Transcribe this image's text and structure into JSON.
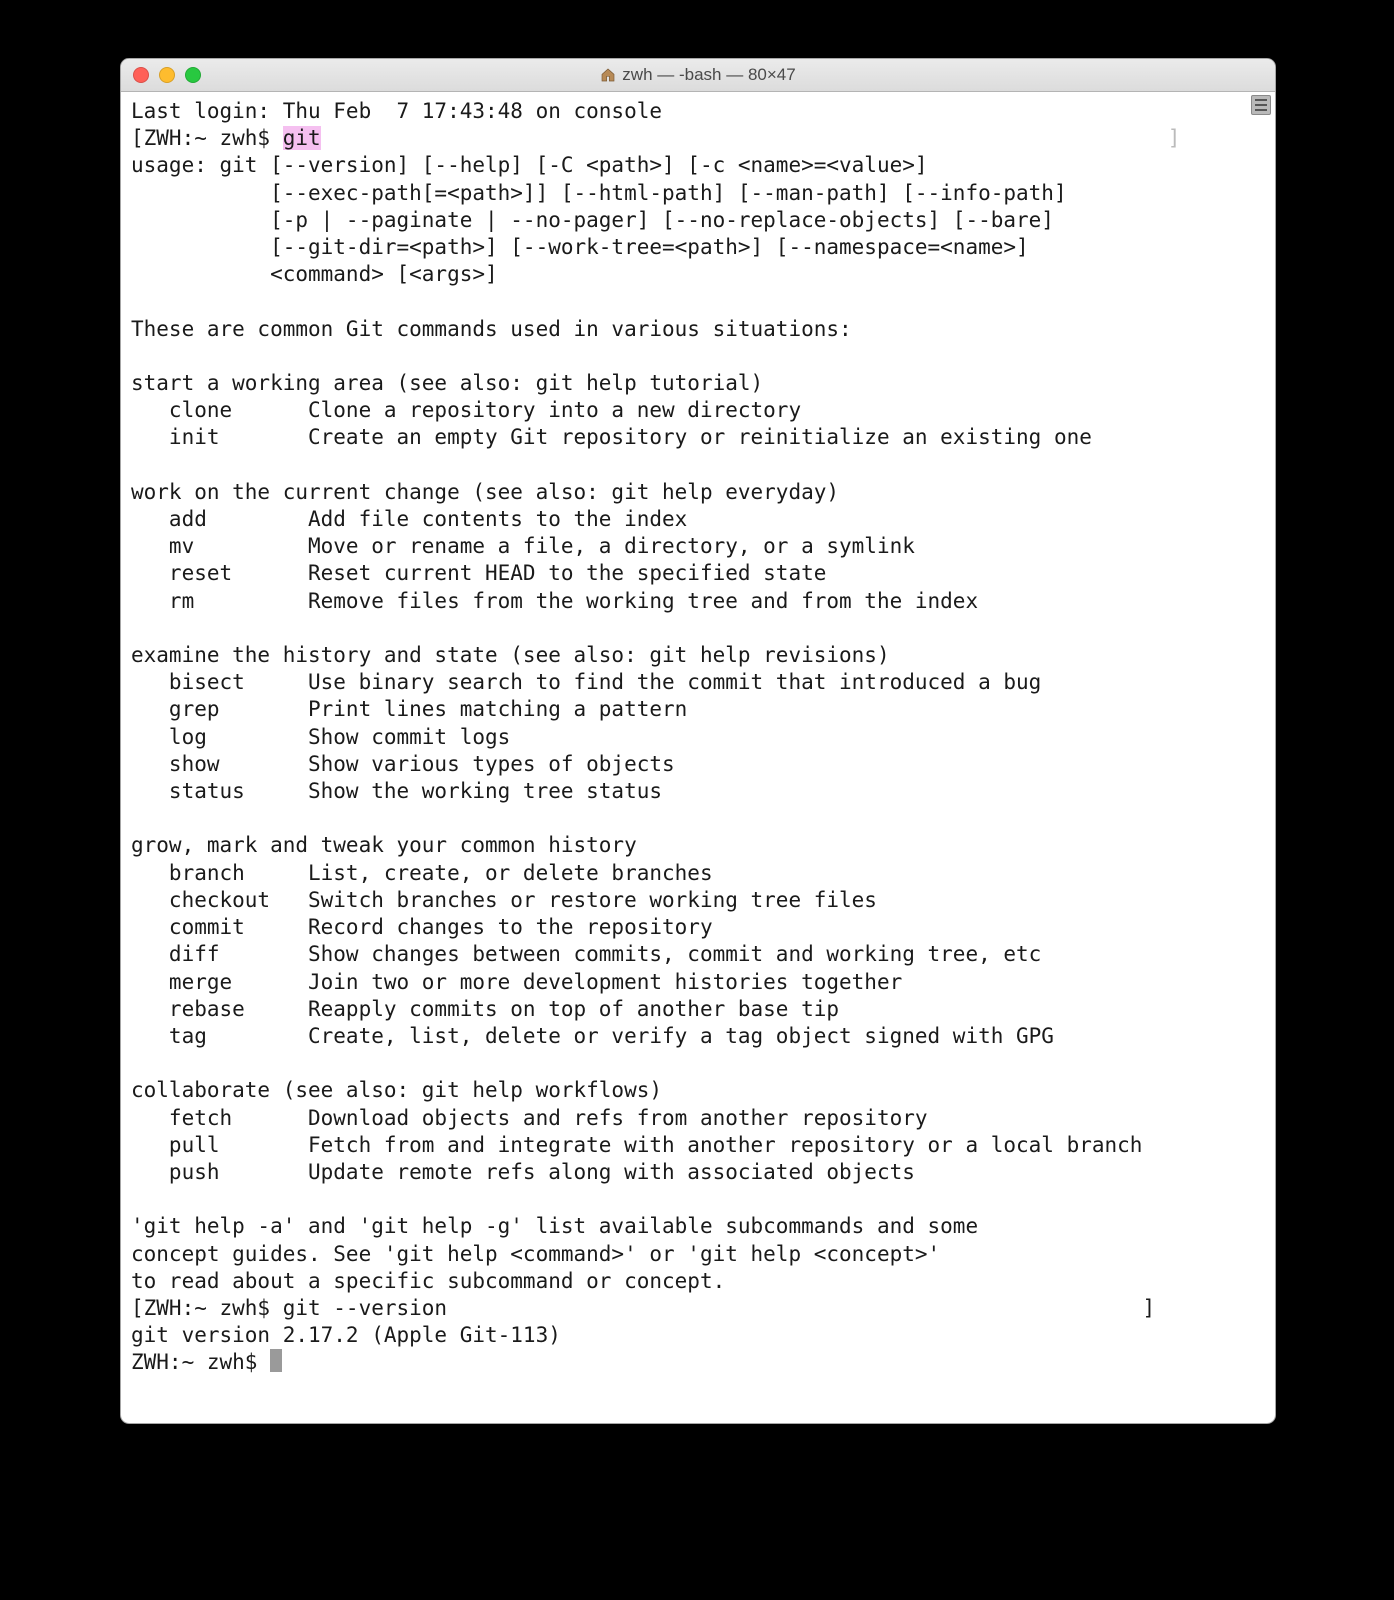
{
  "window": {
    "title": "zwh — -bash — 80×47"
  },
  "session": {
    "last_login": "Last login: Thu Feb  7 17:43:48 on console",
    "prompt1_pre": "[ZWH:~ zwh$ ",
    "prompt1_cmd": "git",
    "prompt1_post": "                                                                   ]",
    "usage_lines": [
      "usage: git [--version] [--help] [-C <path>] [-c <name>=<value>]",
      "           [--exec-path[=<path>]] [--html-path] [--man-path] [--info-path]",
      "           [-p | --paginate | --no-pager] [--no-replace-objects] [--bare]",
      "           [--git-dir=<path>] [--work-tree=<path>] [--namespace=<name>]",
      "           <command> [<args>]"
    ],
    "intro": "These are common Git commands used in various situations:",
    "sections": [
      {
        "header": "start a working area (see also: git help tutorial)",
        "items": [
          {
            "cmd": "clone",
            "desc": "Clone a repository into a new directory"
          },
          {
            "cmd": "init",
            "desc": "Create an empty Git repository or reinitialize an existing one"
          }
        ]
      },
      {
        "header": "work on the current change (see also: git help everyday)",
        "items": [
          {
            "cmd": "add",
            "desc": "Add file contents to the index"
          },
          {
            "cmd": "mv",
            "desc": "Move or rename a file, a directory, or a symlink"
          },
          {
            "cmd": "reset",
            "desc": "Reset current HEAD to the specified state"
          },
          {
            "cmd": "rm",
            "desc": "Remove files from the working tree and from the index"
          }
        ]
      },
      {
        "header": "examine the history and state (see also: git help revisions)",
        "items": [
          {
            "cmd": "bisect",
            "desc": "Use binary search to find the commit that introduced a bug"
          },
          {
            "cmd": "grep",
            "desc": "Print lines matching a pattern"
          },
          {
            "cmd": "log",
            "desc": "Show commit logs"
          },
          {
            "cmd": "show",
            "desc": "Show various types of objects"
          },
          {
            "cmd": "status",
            "desc": "Show the working tree status"
          }
        ]
      },
      {
        "header": "grow, mark and tweak your common history",
        "items": [
          {
            "cmd": "branch",
            "desc": "List, create, or delete branches"
          },
          {
            "cmd": "checkout",
            "desc": "Switch branches or restore working tree files"
          },
          {
            "cmd": "commit",
            "desc": "Record changes to the repository"
          },
          {
            "cmd": "diff",
            "desc": "Show changes between commits, commit and working tree, etc"
          },
          {
            "cmd": "merge",
            "desc": "Join two or more development histories together"
          },
          {
            "cmd": "rebase",
            "desc": "Reapply commits on top of another base tip"
          },
          {
            "cmd": "tag",
            "desc": "Create, list, delete or verify a tag object signed with GPG"
          }
        ]
      },
      {
        "header": "collaborate (see also: git help workflows)",
        "items": [
          {
            "cmd": "fetch",
            "desc": "Download objects and refs from another repository"
          },
          {
            "cmd": "pull",
            "desc": "Fetch from and integrate with another repository or a local branch"
          },
          {
            "cmd": "push",
            "desc": "Update remote refs along with associated objects"
          }
        ]
      }
    ],
    "footer_lines": [
      "'git help -a' and 'git help -g' list available subcommands and some",
      "concept guides. See 'git help <command>' or 'git help <concept>'",
      "to read about a specific subcommand or concept."
    ],
    "prompt2": "[ZWH:~ zwh$ git --version                                                       ]",
    "version_out": "git version 2.17.2 (Apple Git-113)",
    "prompt3": "ZWH:~ zwh$ "
  }
}
